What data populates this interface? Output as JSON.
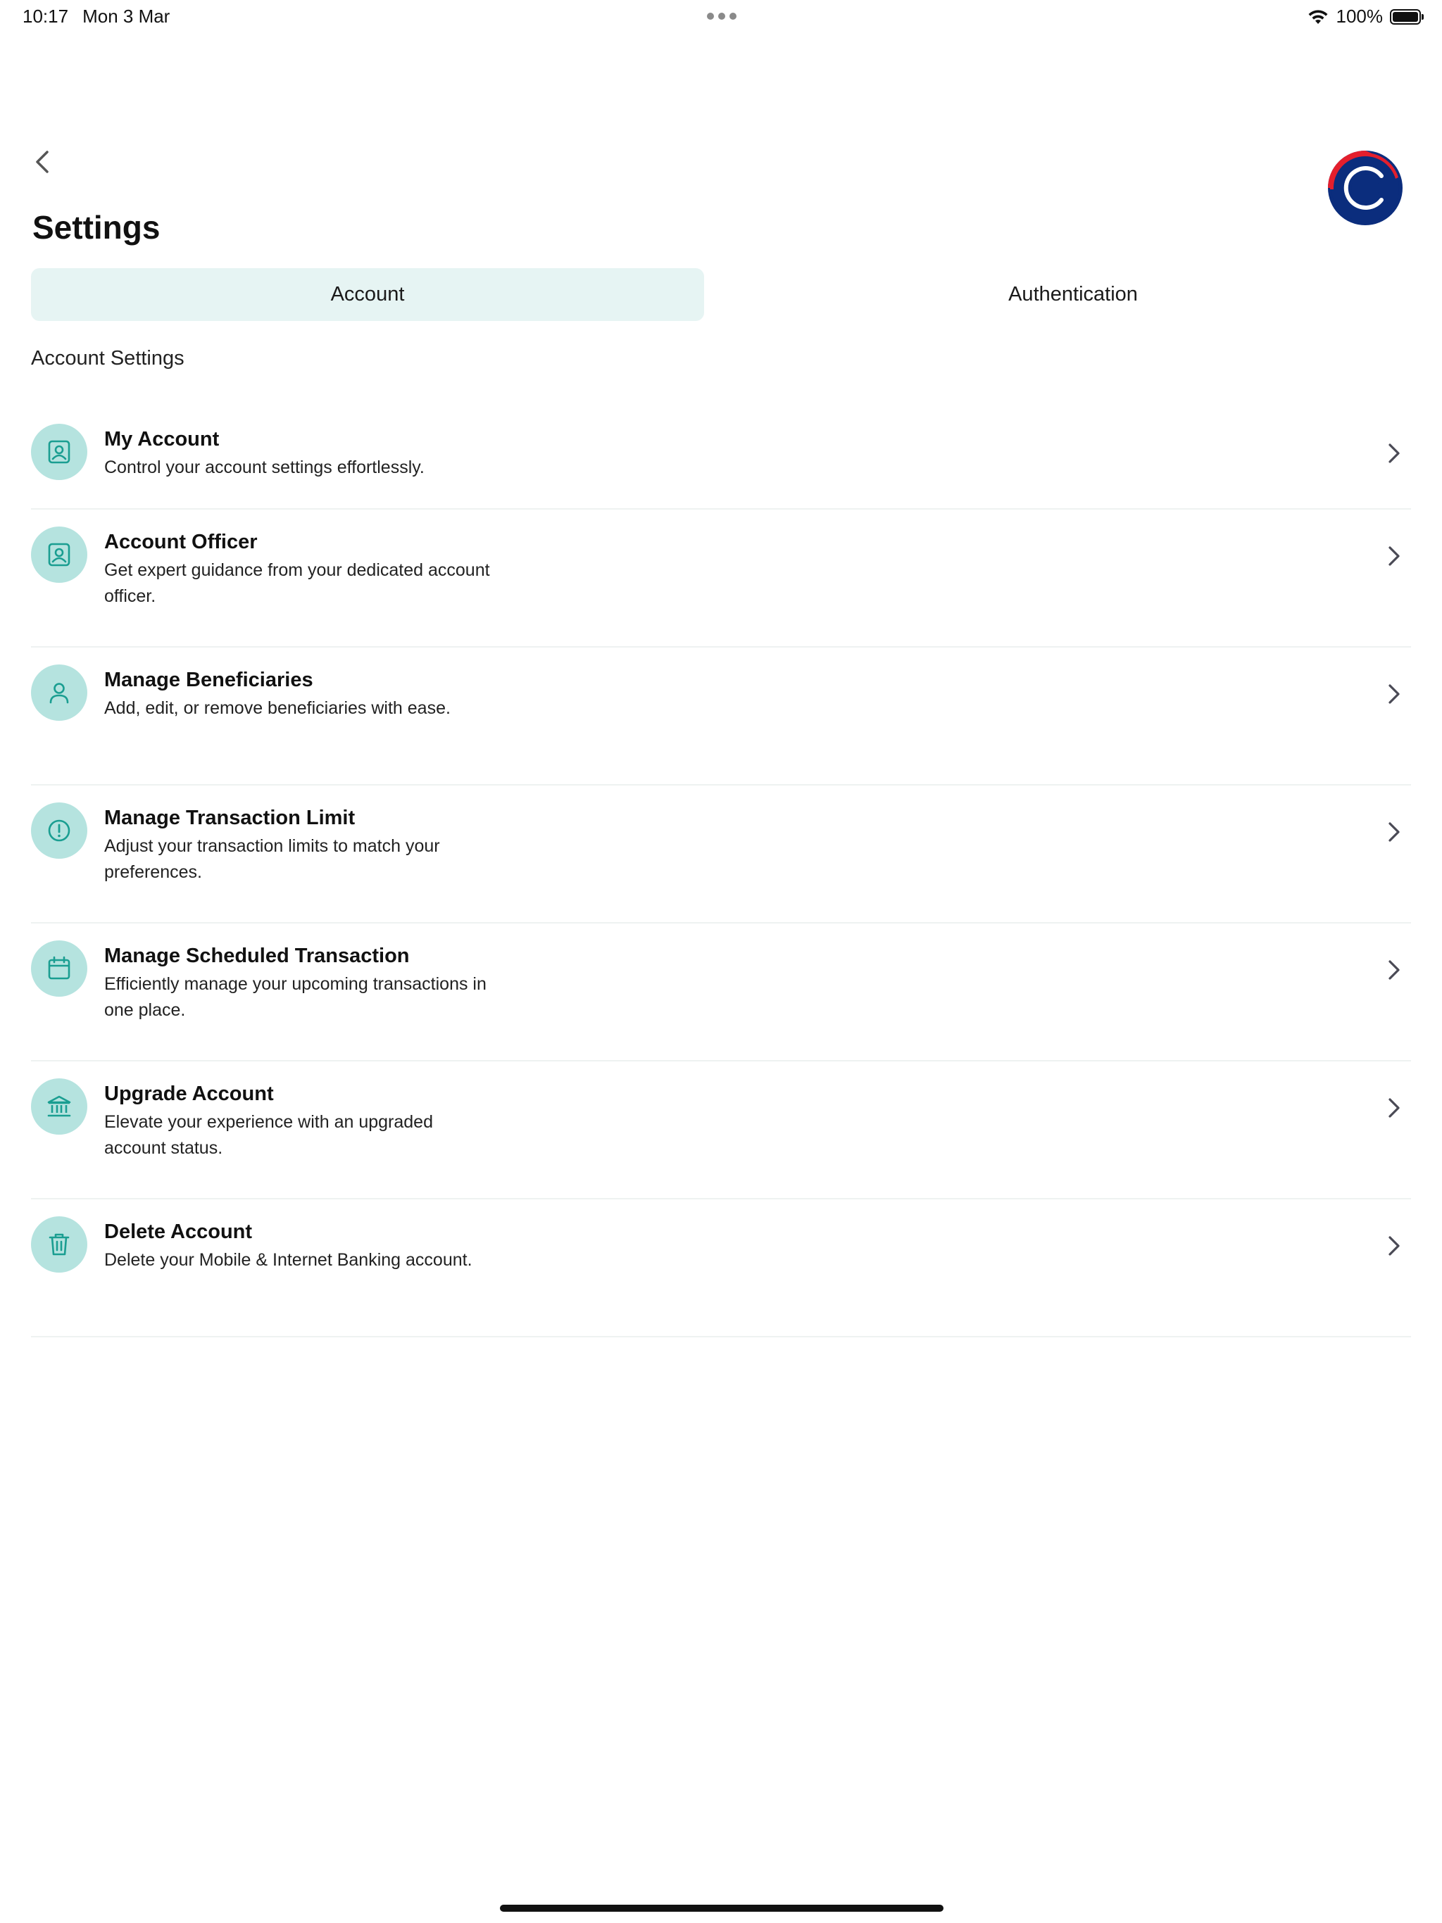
{
  "status_bar": {
    "time": "10:17",
    "date": "Mon 3 Mar",
    "battery_percent": "100%",
    "battery_level": 1.0,
    "wifi_icon": "wifi-icon",
    "battery_icon": "battery-icon"
  },
  "header": {
    "back_icon": "chevron-left-icon",
    "logo_icon": "brand-logo",
    "title": "Settings"
  },
  "tabs": [
    {
      "label": "Account",
      "selected": true
    },
    {
      "label": "Authentication",
      "selected": false
    }
  ],
  "section": {
    "heading": "Account Settings"
  },
  "items": [
    {
      "title": "My Account",
      "description": "Control your account settings effortlessly.",
      "icon": "user-card-icon"
    },
    {
      "title": "Account Officer",
      "description": "Get expert guidance from your dedicated account officer.",
      "icon": "user-card-icon"
    },
    {
      "title": "Manage Beneficiaries",
      "description": "Add, edit, or remove beneficiaries with ease.",
      "icon": "user-icon"
    },
    {
      "title": "Manage Transaction Limit",
      "description": "Adjust your transaction limits to match your preferences.",
      "icon": "alert-circle-icon"
    },
    {
      "title": "Manage Scheduled Transaction",
      "description": "Efficiently manage your upcoming transactions in one place.",
      "icon": "calendar-icon"
    },
    {
      "title": "Upgrade Account",
      "description": "Elevate your experience with an upgraded account status.",
      "icon": "bank-icon"
    },
    {
      "title": "Delete Account",
      "description": "Delete your Mobile & Internet Banking account.",
      "icon": "trash-icon"
    }
  ],
  "colors": {
    "accent": "#1a9e91",
    "icon_background": "#b5e3df",
    "tab_selected_background": "#e6f4f3",
    "logo_blue": "#0b2d7d",
    "logo_red": "#e41f2d"
  }
}
